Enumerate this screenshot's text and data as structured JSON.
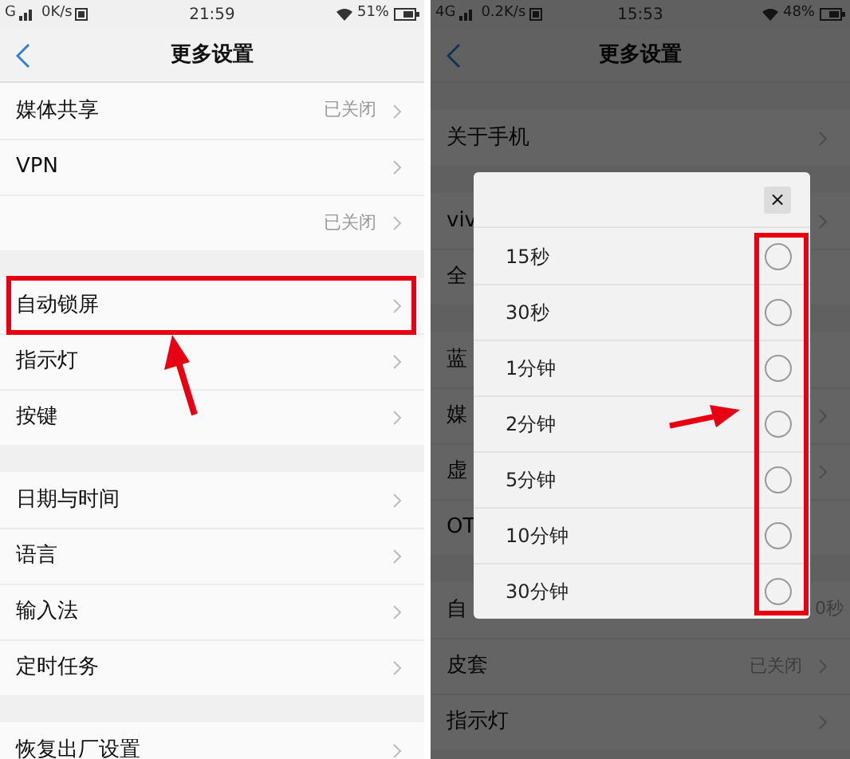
{
  "left_screen": {
    "status_bar": {
      "network": "G",
      "speed": "0K/s",
      "time": "21:59",
      "battery": "51%"
    },
    "header": {
      "title": "更多设置"
    },
    "groups": [
      {
        "rows": [
          {
            "label": "媒体共享",
            "value": "已关闭",
            "chevron": true
          },
          {
            "label": "VPN",
            "chevron": true
          },
          {
            "label": "",
            "value": "已关闭",
            "chevron": true
          }
        ]
      },
      {
        "rows": [
          {
            "label": "自动锁屏",
            "chevron": true
          },
          {
            "label": "指示灯",
            "chevron": true
          },
          {
            "label": "按键",
            "chevron": true
          }
        ]
      },
      {
        "rows": [
          {
            "label": "日期与时间",
            "chevron": true
          },
          {
            "label": "语言",
            "chevron": true
          },
          {
            "label": "输入法",
            "chevron": true
          },
          {
            "label": "定时任务",
            "chevron": true
          }
        ]
      },
      {
        "rows": [
          {
            "label": "恢复出厂设置",
            "chevron": true
          }
        ]
      }
    ]
  },
  "right_screen": {
    "status_bar": {
      "network": "4G",
      "speed": "0.2K/s",
      "time": "15:53",
      "battery": "48%"
    },
    "header": {
      "title": "更多设置"
    },
    "groups": [
      {
        "rows": [
          {
            "label": "关于手机",
            "chevron": true
          }
        ]
      },
      {
        "rows": [
          {
            "label": "viv",
            "chevron": true
          },
          {
            "label": "全",
            "chevron": false
          }
        ]
      },
      {
        "rows": [
          {
            "label": "蓝",
            "chevron": false
          },
          {
            "label": "媒",
            "chevron": true
          },
          {
            "label": "虚",
            "chevron": true
          },
          {
            "label": "OT",
            "chevron": false
          }
        ]
      },
      {
        "rows": [
          {
            "label": "自",
            "value": "0秒",
            "chevron": false
          },
          {
            "label": "皮套",
            "value": "已关闭",
            "chevron": true
          },
          {
            "label": "指示灯",
            "chevron": true
          }
        ]
      }
    ],
    "dialog": {
      "close": "×",
      "options": [
        {
          "label": "15秒",
          "selected": false
        },
        {
          "label": "30秒",
          "selected": false
        },
        {
          "label": "1分钟",
          "selected": false
        },
        {
          "label": "2分钟",
          "selected": false
        },
        {
          "label": "5分钟",
          "selected": false
        },
        {
          "label": "10分钟",
          "selected": false
        },
        {
          "label": "30分钟",
          "selected": false
        }
      ]
    }
  }
}
